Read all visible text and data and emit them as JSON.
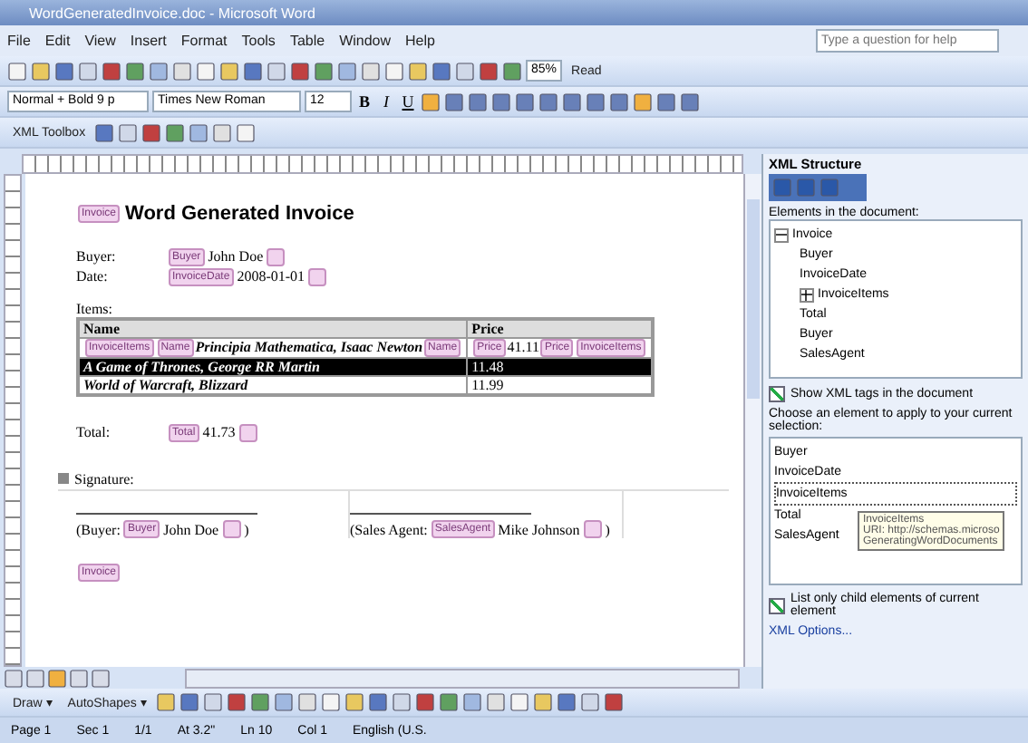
{
  "window": {
    "title": "WordGeneratedInvoice.doc - Microsoft Word"
  },
  "menu": [
    "File",
    "Edit",
    "View",
    "Insert",
    "Format",
    "Tools",
    "Table",
    "Window",
    "Help"
  ],
  "help_box": {
    "placeholder": "Type a question for help"
  },
  "standard_toolbar": {
    "zoom": "85%",
    "read": "Read"
  },
  "formatting_toolbar": {
    "style": "Normal + Bold 9 p",
    "font": "Times New Roman",
    "size": "12",
    "bold": "B",
    "italic": "I",
    "underline": "U"
  },
  "xml_toolbar": {
    "label": "XML Toolbox"
  },
  "document": {
    "heading_tag": "Invoice",
    "title": "Word Generated Invoice",
    "fields": [
      {
        "label": "Buyer:",
        "tag": "Buyer",
        "value": "John Doe"
      },
      {
        "label": "Date:",
        "tag": "InvoiceDate",
        "value": "2008-01-01"
      }
    ],
    "items_label": "Items:",
    "columns": [
      "Name",
      "Price"
    ],
    "rows": [
      {
        "selected": false,
        "name": [
          {
            "kind": "tag",
            "text": "InvoiceItems"
          },
          {
            "kind": "tag",
            "text": "Name"
          },
          {
            "kind": "text",
            "text": "Principia Mathematica, Isaac Newton"
          },
          {
            "kind": "tag",
            "text": "Name"
          }
        ],
        "price": [
          {
            "kind": "tag",
            "text": "Price"
          },
          {
            "kind": "text",
            "text": "41.11"
          },
          {
            "kind": "tag",
            "text": "Price"
          },
          {
            "kind": "tag",
            "text": "InvoiceItems"
          }
        ]
      },
      {
        "selected": true,
        "name": [
          {
            "kind": "text",
            "text": "A Game of Thrones, George RR Martin"
          }
        ],
        "price": [
          {
            "kind": "text",
            "text": "11.48"
          }
        ]
      },
      {
        "selected": false,
        "name": [
          {
            "kind": "text",
            "text": "World of Warcraft, Blizzard"
          }
        ],
        "price": [
          {
            "kind": "text",
            "text": "11.99"
          }
        ]
      }
    ],
    "total": {
      "label": "Total:",
      "tag": "Total",
      "value": "41.73"
    },
    "signature_label": "Signature:",
    "signatures": [
      {
        "prefix": "(Buyer:",
        "tag": "Buyer",
        "value": "John Doe",
        "suffix": ")"
      },
      {
        "prefix": "(Sales Agent:",
        "tag": "SalesAgent",
        "value": "Mike Johnson",
        "suffix": ")"
      }
    ],
    "end_tag": "Invoice"
  },
  "xml_pane": {
    "title": "XML Structure",
    "elements_label": "Elements in the document:",
    "tree": [
      {
        "label": "Invoice",
        "expanded": true,
        "children": [
          {
            "label": "Buyer"
          },
          {
            "label": "InvoiceDate"
          },
          {
            "label": "InvoiceItems",
            "expanded": false
          },
          {
            "label": "Total"
          },
          {
            "label": "Buyer"
          },
          {
            "label": "SalesAgent"
          }
        ]
      }
    ],
    "show_tags": {
      "label": "Show XML tags in the document",
      "checked": true
    },
    "choose_label": "Choose an element to apply to your current selection:",
    "choices": [
      {
        "label": "Buyer",
        "selected": false
      },
      {
        "label": "InvoiceDate",
        "selected": false
      },
      {
        "label": "InvoiceItems",
        "selected": true
      },
      {
        "label": "Total",
        "selected": false
      },
      {
        "label": "SalesAgent",
        "selected": false
      }
    ],
    "tooltip": [
      "InvoiceItems",
      "URI: http://schemas.microso",
      "GeneratingWordDocuments"
    ],
    "child_only": {
      "label": "List only child elements of current element",
      "checked": true
    },
    "options_link": "XML Options..."
  },
  "draw_toolbar": {
    "draw": "Draw ▾",
    "autoshapes": "AutoShapes ▾"
  },
  "status_bar": [
    "Page 1",
    "Sec 1",
    "1/1",
    "At 3.2\"",
    "Ln 10",
    "Col 1",
    "English (U.S."
  ]
}
